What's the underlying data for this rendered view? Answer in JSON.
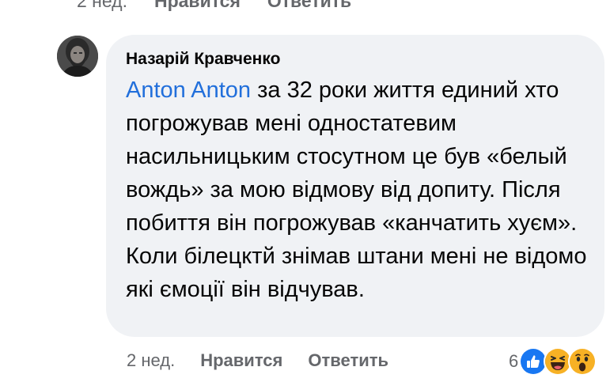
{
  "previous_comment": {
    "time": "2 нед.",
    "like_label": "Нравится",
    "reply_label": "Ответить"
  },
  "comment": {
    "author": "Назарій Кравченко",
    "mention": "Anton Anton",
    "text": "  за 32 роки життя единий хто погрожував мені одностатевим насильницьким стосутном це був «белый вождь» за мою відмову від допиту. Після побиття він погрожував «канчатить хуєм». Коли білецктй знімав штани мені не відомо які ємоції він відчував.",
    "time": "2 нед.",
    "like_label": "Нравится",
    "reply_label": "Ответить",
    "reaction_count": "6",
    "reaction_icons": [
      "like-icon",
      "haha-icon",
      "wow-icon"
    ],
    "colors": {
      "bubble": "#f0f2f5",
      "mention": "#216fdb",
      "meta_text": "#65676b",
      "like_blue": "#1877f2",
      "emoji_yellow": "#f7b125"
    }
  }
}
